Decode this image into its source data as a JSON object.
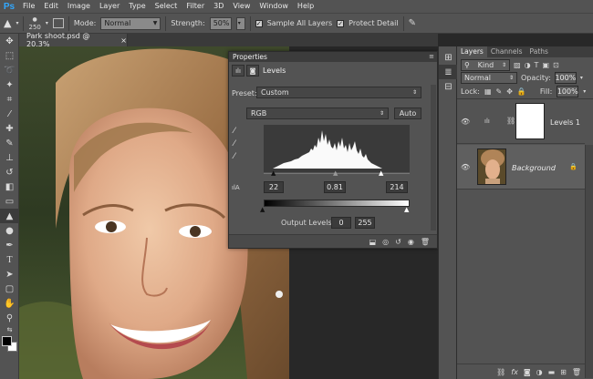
{
  "app": {
    "logo": "Ps"
  },
  "menu": [
    "File",
    "Edit",
    "Image",
    "Layer",
    "Type",
    "Select",
    "Filter",
    "3D",
    "View",
    "Window",
    "Help"
  ],
  "options": {
    "brush_size": "250",
    "mode_label": "Mode:",
    "mode_value": "Normal",
    "strength_label": "Strength:",
    "strength_value": "50%",
    "sample_all_layers": "Sample All Layers",
    "protect_detail": "Protect Detail"
  },
  "document": {
    "tab_title": "Park shoot.psd @ 20.3%",
    "close": "×"
  },
  "properties": {
    "panel_title": "Properties",
    "adjustment_name": "Levels",
    "preset_label": "Preset:",
    "preset_value": "Custom",
    "channel_value": "RGB",
    "auto_button": "Auto",
    "input_black": "22",
    "input_gamma": "0.81",
    "input_white": "214",
    "output_label": "Output Levels:",
    "output_black": "0",
    "output_white": "255",
    "close": "×"
  },
  "layers_panel": {
    "tabs": [
      "Layers",
      "Channels",
      "Paths"
    ],
    "filter_kind": "Kind",
    "blend_mode": "Normal",
    "opacity_label": "Opacity:",
    "opacity_value": "100%",
    "lock_label": "Lock:",
    "fill_label": "Fill:",
    "fill_value": "100%",
    "layers": [
      {
        "name": "Levels 1"
      },
      {
        "name": "Background"
      }
    ]
  },
  "colors": {
    "accent": "#31a8ff",
    "panel": "#535353",
    "dark": "#282828"
  }
}
